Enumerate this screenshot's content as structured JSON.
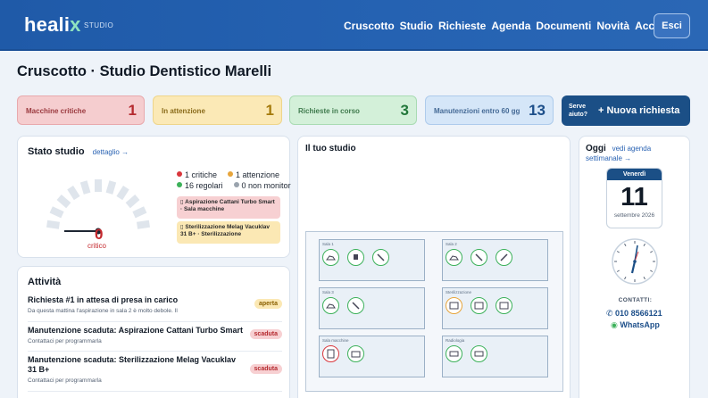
{
  "header": {
    "brand": "heali",
    "brand_mark": "x",
    "brand_sub": "STUDIO",
    "nav": [
      "Cruscotto",
      "Studio",
      "Richieste",
      "Agenda",
      "Documenti",
      "Novità",
      "Account"
    ],
    "exit_label": "Esci"
  },
  "page": {
    "title": "Cruscotto · Studio Dentistico Marelli"
  },
  "kpis": [
    {
      "label": "Macchine critiche",
      "value": "1"
    },
    {
      "label": "In attenzione",
      "value": "1"
    },
    {
      "label": "Richieste in corso",
      "value": "3"
    },
    {
      "label": "Manutenzioni entro 60 gg",
      "value": "13"
    }
  ],
  "new_request": {
    "hint": "Serve aiuto?",
    "label": "+ Nuova richiesta"
  },
  "stato": {
    "title": "Stato studio",
    "link": "dettaglio →",
    "gauge_value": "0",
    "gauge_label": "critico",
    "gauge_fraction": 0.0,
    "legend": [
      {
        "text": "1 critiche",
        "color": "#d9363c"
      },
      {
        "text": "1 attenzione",
        "color": "#e7a53b"
      },
      {
        "text": "16 regolari",
        "color": "#3cb15a"
      },
      {
        "text": "0 non monitor",
        "color": "#9aa3ad"
      }
    ],
    "alerts": [
      {
        "text": "Aspirazione Cattani Turbo Smart · Sala macchine"
      },
      {
        "text": "Sterilizzazione Melag Vacuklav 31 B+ · Sterilizzazione"
      }
    ]
  },
  "attivita": {
    "title": "Attività",
    "items": [
      {
        "title": "Richiesta #1 in attesa di presa in carico",
        "subtitle": "Da questa mattina l'aspirazione in sala 2 è molto debole. Il",
        "badge": "aperta"
      },
      {
        "title": "Manutenzione scaduta: Aspirazione Cattani Turbo Smart",
        "subtitle": "Contattaci per programmarla",
        "badge": "scaduta"
      },
      {
        "title": "Manutenzione scaduta: Sterilizzazione Melag Vacuklav 31 B+",
        "subtitle": "Contattaci per programmarla",
        "badge": "scaduta"
      }
    ]
  },
  "studio": {
    "title": "Il tuo studio",
    "rooms": [
      {
        "name": "Sala 1"
      },
      {
        "name": "Sala 2"
      },
      {
        "name": "Sala 3"
      },
      {
        "name": "Sterilizzazione"
      },
      {
        "name": "Sala macchine"
      },
      {
        "name": "Radiologia"
      }
    ]
  },
  "oggi": {
    "title": "Oggi",
    "link": "vedi agenda settimanale →",
    "weekday": "Venerdì",
    "day": "11",
    "month_year": "settembre 2026",
    "contacts_label": "CONTATTI:",
    "phone": "010 8566121",
    "whatsapp": "WhatsApp"
  },
  "colors": {
    "brand_blue": "#1f5aa8",
    "critical": "#d9363c",
    "warning": "#e7a53b",
    "ok": "#3cb15a",
    "navy": "#1b4f86"
  }
}
